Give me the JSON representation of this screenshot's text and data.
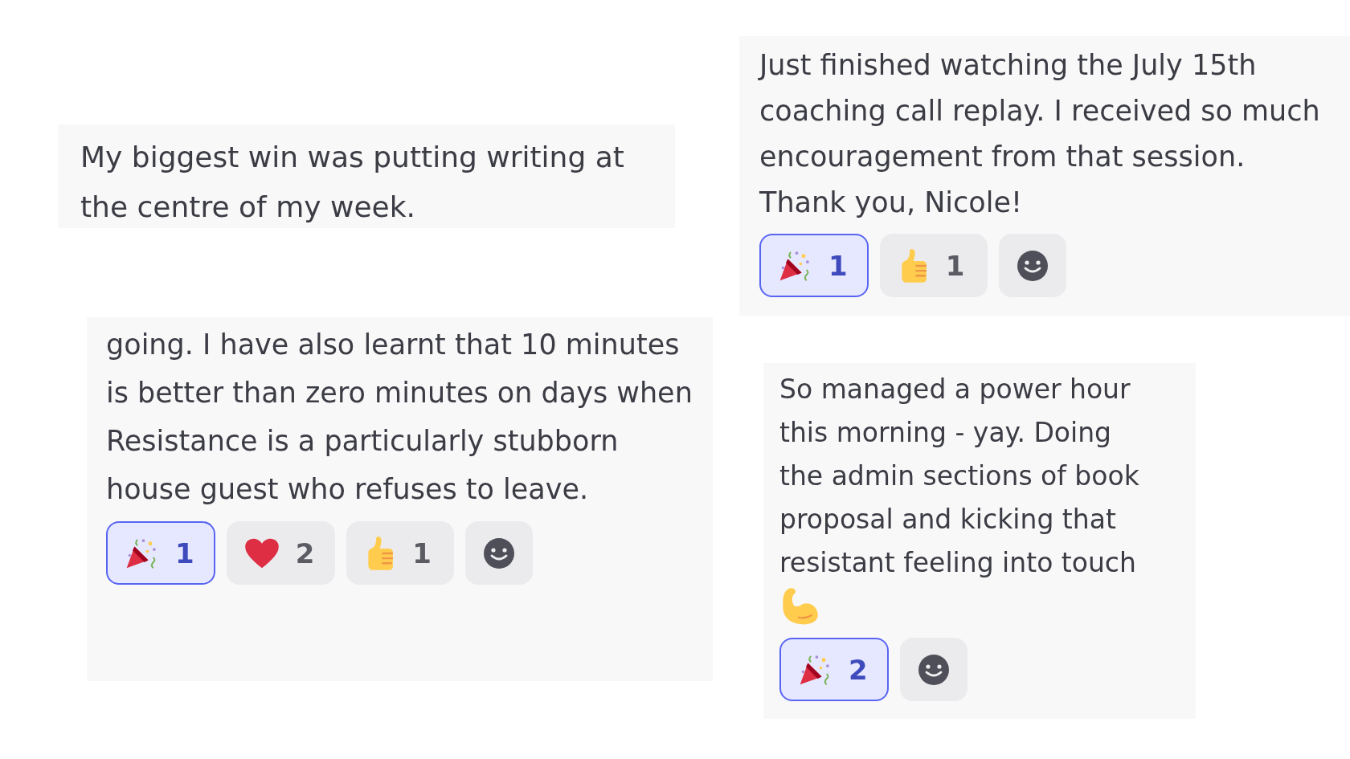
{
  "messages": [
    {
      "text": "My biggest win was putting writing at the centre of my week."
    },
    {
      "text": "Just finished watching the  July 15th coaching call replay. I received so much encouragement from that session. Thank you, Nicole!",
      "reactions": [
        {
          "kind": "party",
          "count": "1",
          "selected": true
        },
        {
          "kind": "thumbs_up",
          "count": "1",
          "selected": false
        },
        {
          "kind": "add"
        }
      ]
    },
    {
      "text": "going. I have also learnt that 10 minutes is better than zero minutes on days when Resistance is a particularly stubborn house guest who refuses to leave.",
      "reactions": [
        {
          "kind": "party",
          "count": "1",
          "selected": true
        },
        {
          "kind": "heart",
          "count": "2",
          "selected": false
        },
        {
          "kind": "thumbs_up",
          "count": "1",
          "selected": false
        },
        {
          "kind": "add"
        }
      ]
    },
    {
      "text": "So managed a power hour this morning - yay. Doing the admin sections of book proposal and kicking that resistant feeling into touch",
      "end_emoji": {
        "kind": "muscle"
      },
      "reactions": [
        {
          "kind": "party",
          "count": "2",
          "selected": true
        },
        {
          "kind": "add"
        }
      ]
    }
  ]
}
